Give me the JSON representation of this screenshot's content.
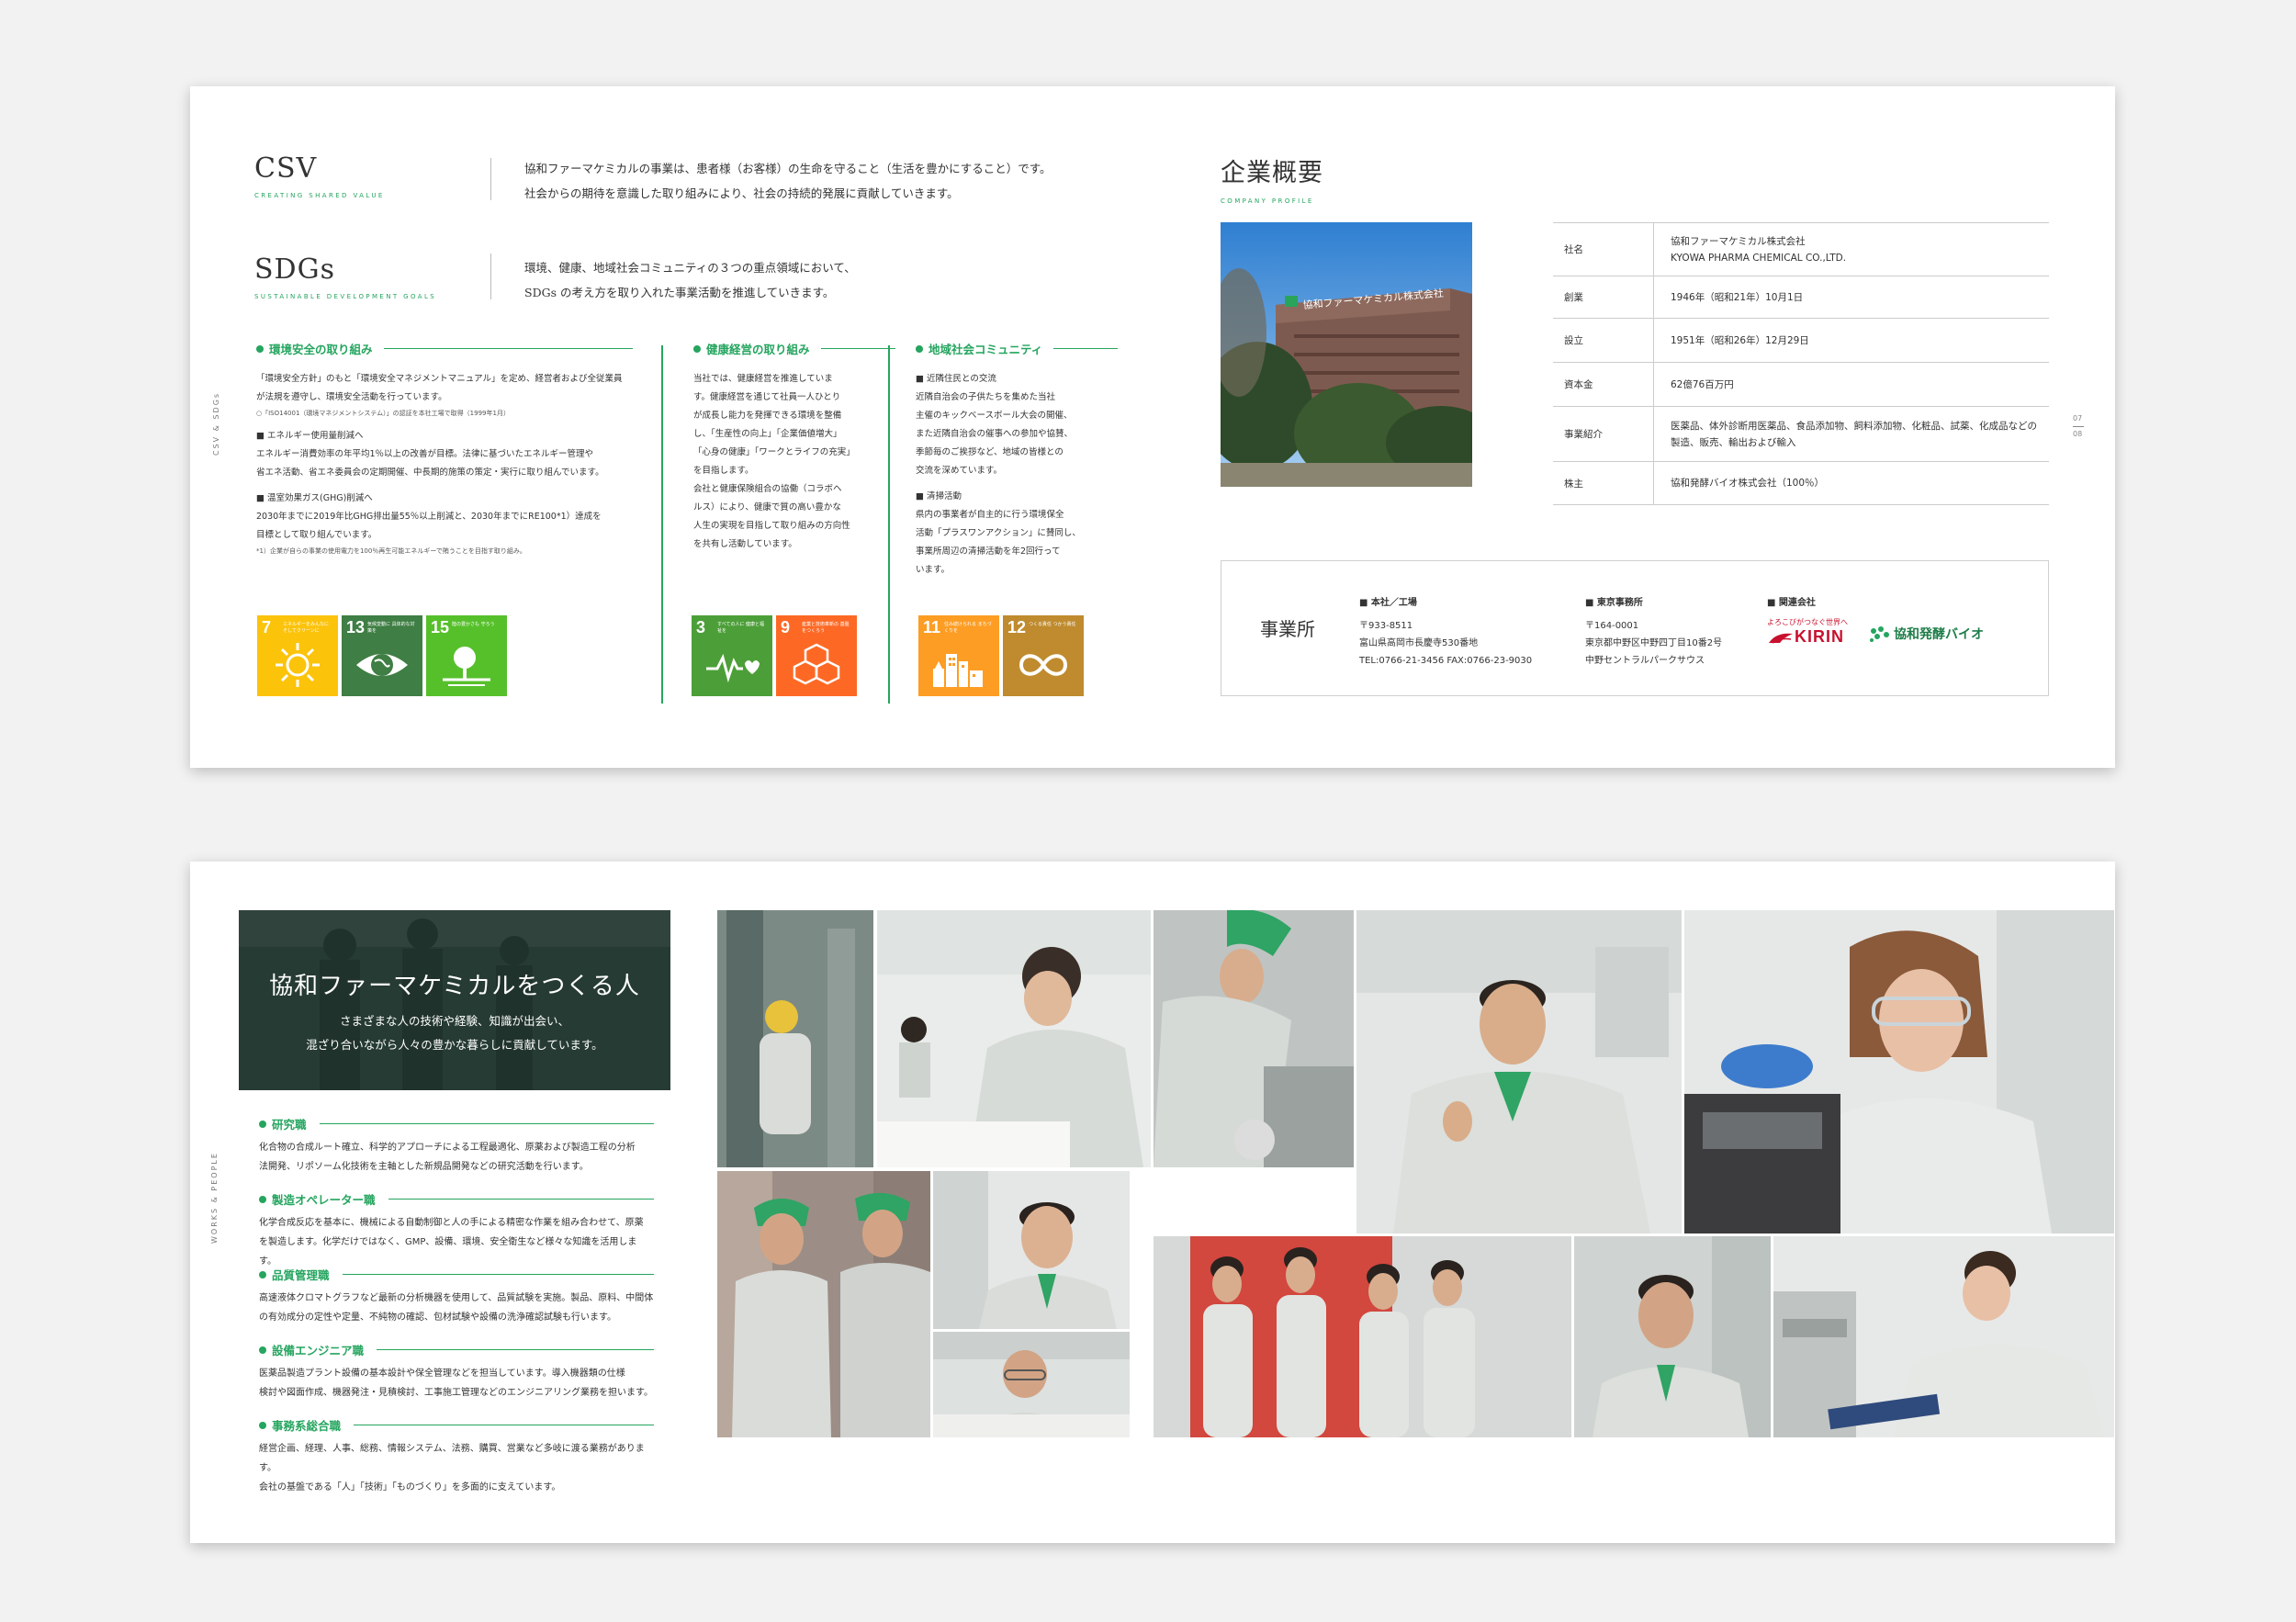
{
  "spread1": {
    "csv": {
      "title": "CSV",
      "subtitle": "CREATING SHARED VALUE",
      "text": [
        "協和ファーマケミカルの事業は、患者様（お客様）の生命を守ること（生活を豊かにすること）です。",
        "社会からの期待を意識した取り組みにより、社会の持続的発展に貢献していきます。"
      ]
    },
    "sdgs": {
      "title": "SDGs",
      "subtitle": "SUSTAINABLE DEVELOPMENT GOALS",
      "text": [
        "環境、健康、地域社会コミュニティの３つの重点領域において、",
        "SDGs の考え方を取り入れた事業活動を推進していきます。"
      ]
    },
    "side_label": "CSV & SDGs",
    "columns": [
      {
        "head": "環境安全の取り組み",
        "lines": [
          "「環境安全方針」のもと「環境安全マネジメントマニュアル」を定め、経営者および全従業員",
          "が法規を遵守し、環境安全活動を行っています。"
        ],
        "note": "○「ISO14001（環境マネジメントシステム）」の認証を本社工場で取得（1999年1月）",
        "items": [
          {
            "title": "■ エネルギー使用量削減へ",
            "text": [
              "エネルギー消費効率の年平均1％以上の改善が目標。法律に基づいたエネルギー管理や",
              "省エネ活動、省エネ委員会の定期開催、中長期的施策の策定・実行に取り組んでいます。"
            ]
          },
          {
            "title": "■ 温室効果ガス(GHG)削減へ",
            "text": [
              "2030年までに2019年比GHG排出量55％以上削減と、2030年までにRE100*1）達成を",
              "目標として取り組んでいます。"
            ]
          }
        ],
        "footnote": "*1）企業が自らの事業の使用電力を100％再生可能エネルギーで賄うことを目指す取り組み。"
      },
      {
        "head": "健康経営の取り組み",
        "lines": [
          "当社では、健康経営を推進していま",
          "す。健康経営を通じて社員一人ひとり",
          "が成長し能力を発揮できる環境を整備",
          "し、「生産性の向上」「企業価値増大」",
          "「心身の健康」「ワークとライフの充実」",
          "を目指します。",
          "会社と健康保険組合の協働（コラボヘ",
          "ルス）により、健康で質の高い豊かな",
          "人生の実現を目指して取り組みの方向性",
          "を共有し活動しています。"
        ]
      },
      {
        "head": "地域社会コミュニティ",
        "items": [
          {
            "title": "■ 近隣住民との交流",
            "text": [
              "近隣自治会の子供たちを集めた当社",
              "主催のキックベースボール大会の開催、",
              "また近隣自治会の催事への参加や協賛、",
              "季節毎のご挨拶など、地域の皆様との",
              "交流を深めています。"
            ]
          },
          {
            "title": "■ 清掃活動",
            "text": [
              "県内の事業者が自主的に行う環境保全",
              "活動「プラスワンアクション」に賛同し、",
              "事業所周辺の清掃活動を年2回行って",
              "います。"
            ]
          }
        ]
      }
    ],
    "sdg_icons": [
      {
        "num": "7",
        "label": "エネルギーをみんなに そしてクリーンに",
        "color": "#fcc30b",
        "icon": "sun-icon"
      },
      {
        "num": "13",
        "label": "気候変動に 具体的な対策を",
        "color": "#3f7e44",
        "icon": "eye-globe-icon"
      },
      {
        "num": "15",
        "label": "陸の豊かさも 守ろう",
        "color": "#56c02b",
        "icon": "tree-icon"
      },
      {
        "num": "3",
        "label": "すべての人に 健康と福祉を",
        "color": "#4c9f38",
        "icon": "heartbeat-icon"
      },
      {
        "num": "9",
        "label": "産業と技術革新の 基盤をつくろう",
        "color": "#fd6925",
        "icon": "cubes-icon"
      },
      {
        "num": "11",
        "label": "住み続けられる まちづくりを",
        "color": "#fd9d24",
        "icon": "city-icon"
      },
      {
        "num": "12",
        "label": "つくる責任 つかう責任",
        "color": "#bf8b2e",
        "icon": "infinity-icon"
      }
    ],
    "profile": {
      "title": "企業概要",
      "subtitle": "COMPANY PROFILE",
      "sign_text": "協和ファーマケミカル株式会社",
      "rows": [
        {
          "k": "社名",
          "v": [
            "協和ファーマケミカル株式会社",
            "KYOWA PHARMA CHEMICAL CO.,LTD."
          ]
        },
        {
          "k": "創業",
          "v": [
            "1946年（昭和21年）10月1日"
          ]
        },
        {
          "k": "設立",
          "v": [
            "1951年（昭和26年）12月29日"
          ]
        },
        {
          "k": "資本金",
          "v": [
            "62億76百万円"
          ]
        },
        {
          "k": "事業紹介",
          "v": [
            "医薬品、体外診断用医薬品、食品添加物、飼料添加物、化粧品、試薬、化成品などの",
            "製造、販売、輸出および輸入"
          ]
        },
        {
          "k": "株主",
          "v": [
            "協和発酵バイオ株式会社（100％）"
          ]
        }
      ]
    },
    "offices": {
      "title": "事業所",
      "honsha": {
        "head": "■ 本社／工場",
        "lines": [
          "〒933-8511",
          "富山県高岡市長慶寺530番地",
          "TEL:0766-21-3456  FAX:0766-23-9030"
        ]
      },
      "tokyo": {
        "head": "■ 東京事務所",
        "lines": [
          "〒164-0001",
          "東京都中野区中野四丁目10番2号",
          "中野セントラルパークサウス"
        ]
      },
      "related": {
        "head": "■ 関連会社",
        "kirin_tagline": "よろこびがつなぐ世界へ",
        "kirin": "KIRIN",
        "kyowa_bio": "協和発酵バイオ"
      }
    },
    "page_numbers": [
      "07",
      "08"
    ]
  },
  "spread2": {
    "hero": {
      "title": "協和ファーマケミカルをつくる人",
      "text": [
        "さまざまな人の技術や経験、知識が出会い、",
        "混ざり合いながら人々の豊かな暮らしに貢献しています。"
      ]
    },
    "side_label": "WORKS & PEOPLE",
    "jobs": [
      {
        "title": "研究職",
        "text": [
          "化合物の合成ルート確立、科学的アプローチによる工程最適化、原薬および製造工程の分析",
          "法開発、リポソーム化技術を主軸とした新規品開発などの研究活動を行います。"
        ]
      },
      {
        "title": "製造オペレーター職",
        "text": [
          "化学合成反応を基本に、機械による自動制御と人の手による精密な作業を組み合わせて、原薬",
          "を製造します。化学だけではなく、GMP、設備、環境、安全衛生など様々な知識を活用します。"
        ]
      },
      {
        "title": "品質管理職",
        "text": [
          "高速液体クロマトグラフなど最新の分析機器を使用して、品質試験を実施。製品、原料、中間体",
          "の有効成分の定性や定量、不純物の確認、包材試験や設備の洗浄確認試験も行います。"
        ]
      },
      {
        "title": "設備エンジニア職",
        "text": [
          "医薬品製造プラント設備の基本設計や保全管理などを担当しています。導入機器類の仕様",
          "検討や図面作成、機器発注・見積検討、工事施工管理などのエンジニアリング業務を担います。"
        ]
      },
      {
        "title": "事務系総合職",
        "text": [
          "経営企画、経理、人事、総務、情報システム、法務、購買、営業など多岐に渡る業務があります。",
          "会社の基盤である「人」「技術」「ものづくり」を多面的に支えています。"
        ]
      }
    ]
  }
}
